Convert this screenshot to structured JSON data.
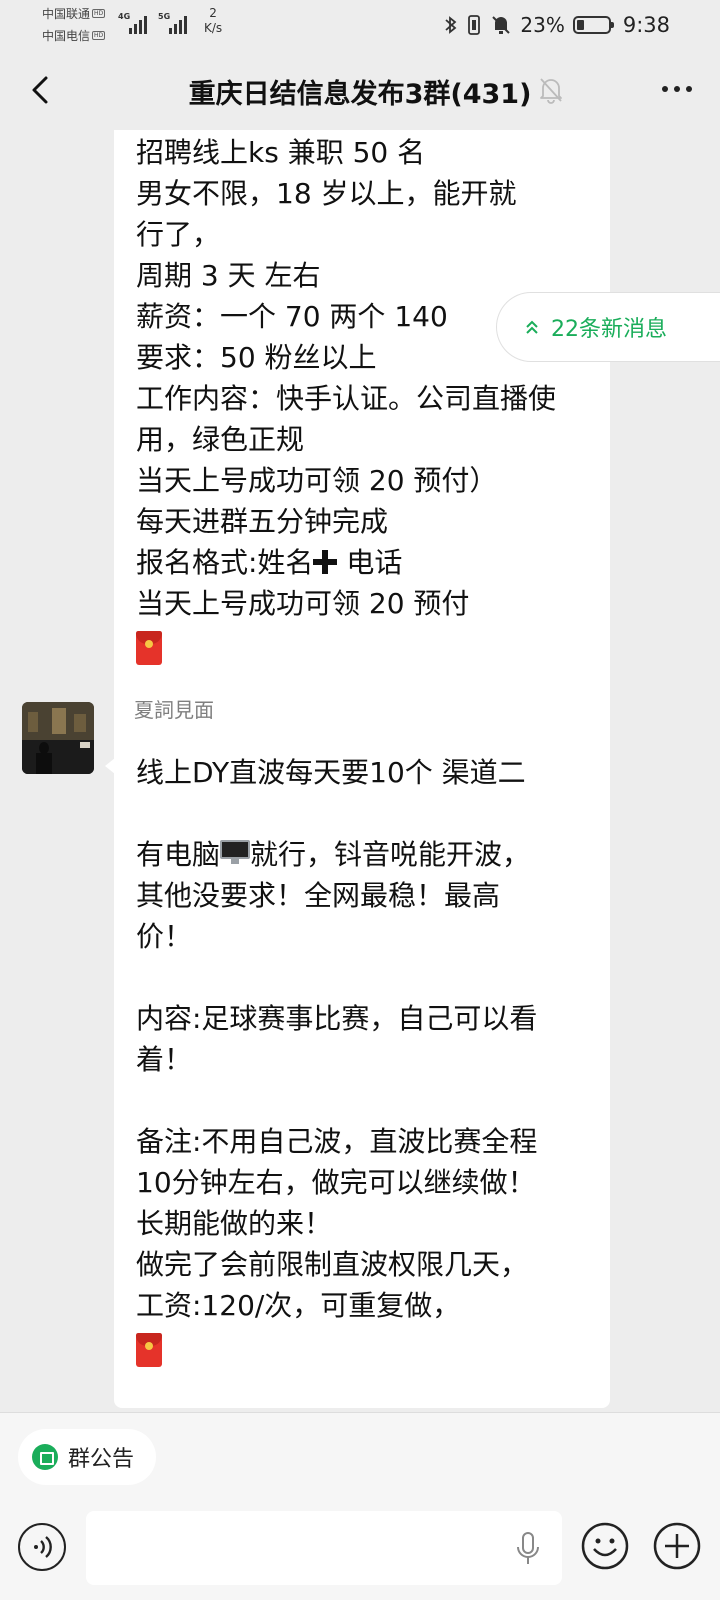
{
  "status_bar": {
    "carrier1": "中国联通",
    "carrier2": "中国电信",
    "hd": "HD",
    "net1": "4G",
    "net2": "5G",
    "speed_value": "2",
    "speed_unit": "K/s",
    "battery_percent": "23%",
    "battery_level": 0.23,
    "time": "9:38"
  },
  "header": {
    "title": "重庆日结信息发布3群(431)"
  },
  "new_messages": {
    "label": "22条新消息"
  },
  "messages": [
    {
      "text": "招聘线上ks 兼职 50 名\n男女不限，18 岁以上，能开就\n行了，\n周期 3 天 左右\n薪资：一个 70 两个 140\n要求：50 粉丝以上\n工作内容：快手认证。公司直播使\n用，绿色正规\n当天上号成功可领 20 预付）\n每天进群五分钟完成\n报名格式:姓名",
      "text_tail": " 电话\n当天上号成功可领 20 预付",
      "emoji_plus": "plus",
      "has_red_packet": true
    },
    {
      "sender": "夏詞見面",
      "text_head": "线上DY直波每天要10个 渠道二\n\n有电脑",
      "emoji_pc": "desktop-computer",
      "text_body": "就行，钭音哾能开波，\n其他没要求！全网最稳！最高\n价！\n\n内容:足球赛事比赛，自己可以看\n着！\n\n备注:不用自己波，直波比赛全程\n10分钟左右，做完可以继续做！\n长期能做的来！\n做完了会前限制直波权限几天，\n工资:120/次，可重复做，",
      "has_red_packet": true
    }
  ],
  "bottom": {
    "notice_chip": "群公告",
    "input_value": ""
  },
  "colors": {
    "background": "#ededed",
    "bubble": "#ffffff",
    "accent_green": "#1aad5a",
    "red_packet": "#e5332a"
  },
  "icons": [
    "back-icon",
    "mute-bell-icon",
    "more-icon",
    "chevron-double-up-icon",
    "voice-icon",
    "mic-icon",
    "emoji-icon",
    "plus-icon",
    "notice-icon"
  ]
}
